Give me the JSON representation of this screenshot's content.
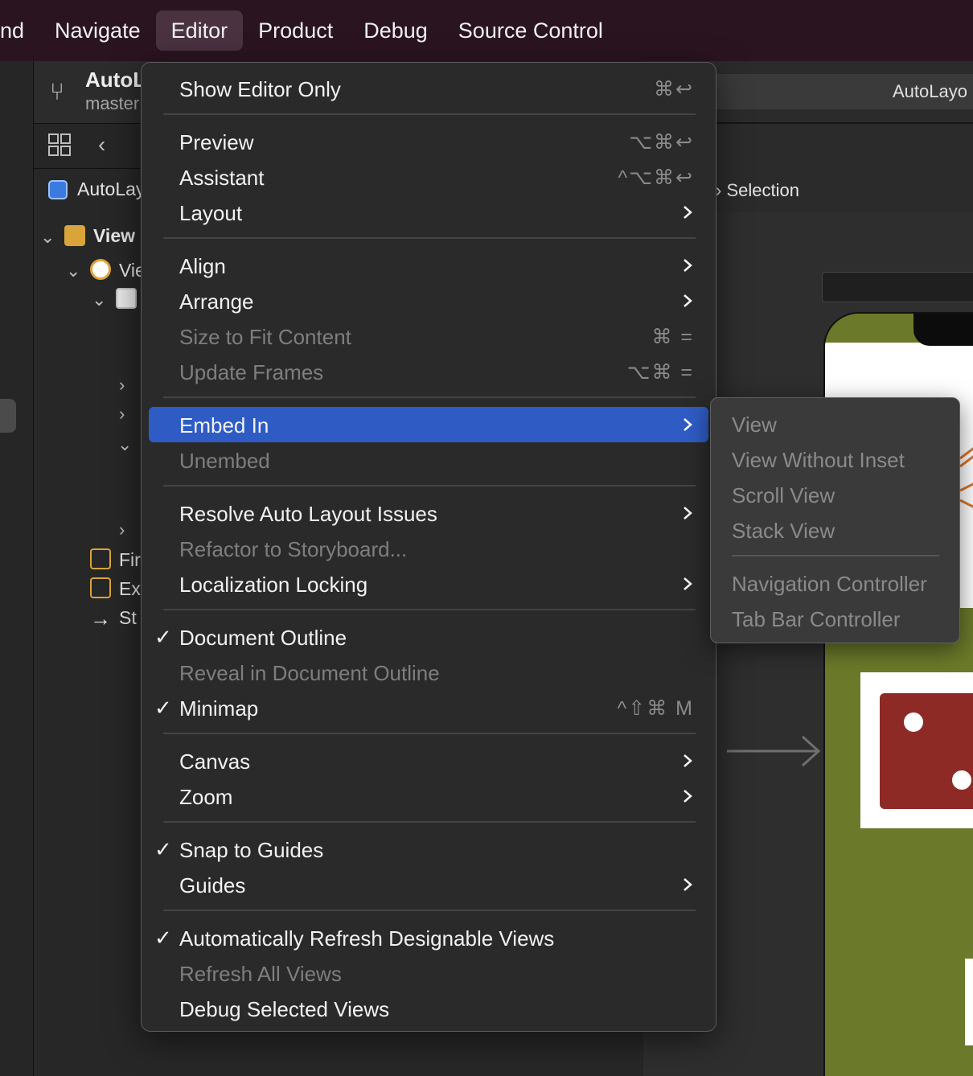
{
  "menubar": {
    "items": [
      "ind",
      "Navigate",
      "Editor",
      "Product",
      "Debug",
      "Source Control"
    ]
  },
  "project": {
    "name": "AutoL",
    "branch": "master"
  },
  "navigator": {
    "app_label": "AutoLay",
    "tree": {
      "view_scene": "View",
      "view_item": "Vie",
      "first_responder": "Fir",
      "exit": "Ex",
      "storyboard_entry": "St"
    }
  },
  "editor_area": {
    "tab_title": "AutoLayo",
    "selection_label": "Selection"
  },
  "menu": {
    "show_editor_only": {
      "label": "Show Editor Only",
      "shortcut": "⌘↩"
    },
    "preview": {
      "label": "Preview",
      "shortcut": "⌥⌘↩"
    },
    "assistant": {
      "label": "Assistant",
      "shortcut": "^⌥⌘↩"
    },
    "layout": {
      "label": "Layout"
    },
    "align": {
      "label": "Align"
    },
    "arrange": {
      "label": "Arrange"
    },
    "size_to_fit": {
      "label": "Size to Fit Content",
      "shortcut": "⌘ ="
    },
    "update_frames": {
      "label": "Update Frames",
      "shortcut": "⌥⌘ ="
    },
    "embed_in": {
      "label": "Embed In"
    },
    "unembed": {
      "label": "Unembed"
    },
    "resolve": {
      "label": "Resolve Auto Layout Issues"
    },
    "refactor": {
      "label": "Refactor to Storyboard..."
    },
    "localization": {
      "label": "Localization Locking"
    },
    "document_outline": {
      "label": "Document Outline"
    },
    "reveal": {
      "label": "Reveal in Document Outline"
    },
    "minimap": {
      "label": "Minimap",
      "shortcut": "^⇧⌘ M"
    },
    "canvas": {
      "label": "Canvas"
    },
    "zoom": {
      "label": "Zoom"
    },
    "snap": {
      "label": "Snap to Guides"
    },
    "guides": {
      "label": "Guides"
    },
    "auto_refresh": {
      "label": "Automatically Refresh Designable Views"
    },
    "refresh_all": {
      "label": "Refresh All Views"
    },
    "debug_selected": {
      "label": "Debug Selected Views"
    },
    "check_glyph": "✓"
  },
  "submenu": {
    "items": [
      "View",
      "View Without Inset",
      "Scroll View",
      "Stack View",
      "Navigation Controller",
      "Tab Bar Controller"
    ]
  },
  "colors": {
    "menubar_bg": "#2a1420",
    "menu_bg": "#2a2a2a",
    "highlight": "#2f5cc4",
    "disabled_text": "#7e7e7e",
    "device_green": "#6b7a2a",
    "dice_red": "#8e2a26"
  }
}
